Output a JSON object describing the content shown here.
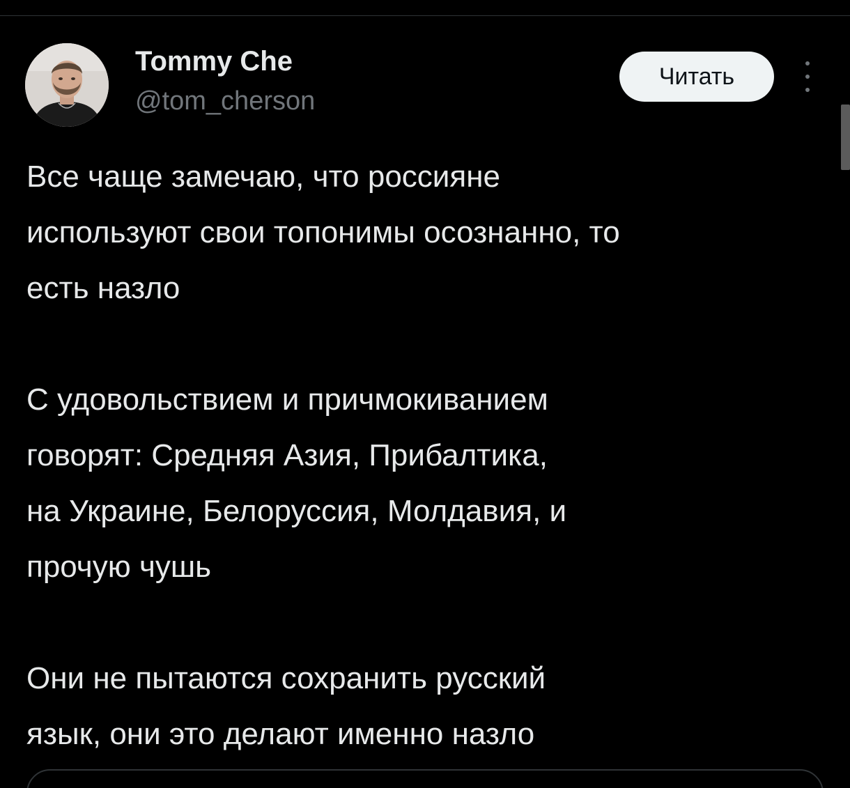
{
  "tweet": {
    "author": {
      "display_name": "Tommy Che",
      "handle": "@tom_cherson"
    },
    "follow_label": "Читать",
    "more_icon": "more-vertical-icon",
    "paragraphs": [
      "Все чаще замечаю, что россияне\nиспользуют свои топонимы осознанно, то\nесть назло",
      "С удовольствием и причмокиванием\nговорят: Средняя Азия, Прибалтика,\nна Украине, Белоруссия, Молдавия, и\nпрочую чушь",
      "Они не пытаются сохранить русский\nязык, они это делают именно назло"
    ]
  },
  "colors": {
    "background": "#000000",
    "text_primary": "#e7e9ea",
    "text_secondary": "#71767b",
    "button_bg": "#eff3f4",
    "button_text": "#0f1419",
    "divider": "#2f3336"
  }
}
